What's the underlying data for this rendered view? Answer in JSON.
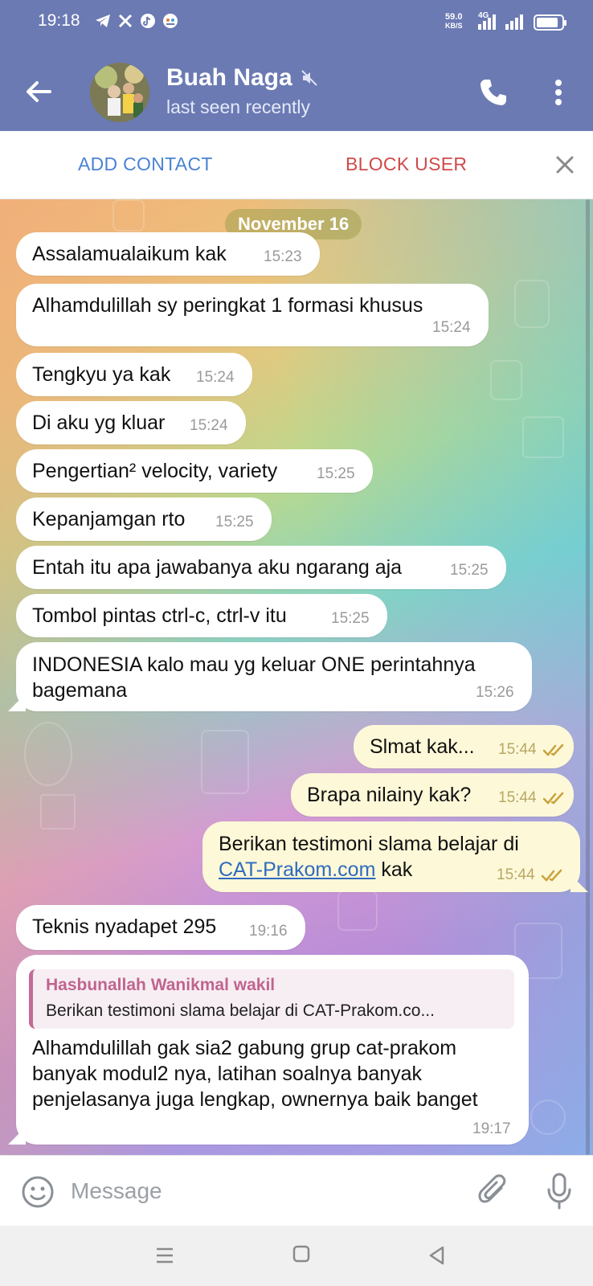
{
  "status_bar": {
    "time": "19:18",
    "net_speed_value": "59.0",
    "net_speed_unit": "KB/S",
    "network_type": "4G",
    "battery_level": 0.85,
    "notification_icons": [
      "telegram-icon",
      "x-icon",
      "tiktok-icon",
      "chat-app-icon"
    ]
  },
  "header": {
    "name": "Buah Naga",
    "status": "last seen recently",
    "muted": true
  },
  "action_bar": {
    "add_contact": "ADD CONTACT",
    "block_user": "BLOCK USER"
  },
  "chat": {
    "date": "November 16",
    "messages": [
      {
        "dir": "in",
        "text": "Assalamualaikum kak",
        "time": "15:23"
      },
      {
        "dir": "in",
        "text": "Alhamdulillah sy peringkat 1 formasi khusus",
        "time": "15:24"
      },
      {
        "dir": "in",
        "text": "Tengkyu ya kak",
        "time": "15:24"
      },
      {
        "dir": "in",
        "text": "Di aku yg kluar",
        "time": "15:24"
      },
      {
        "dir": "in",
        "text": "Pengertian² velocity, variety",
        "time": "15:25"
      },
      {
        "dir": "in",
        "text": "Kepanjamgan rto",
        "time": "15:25"
      },
      {
        "dir": "in",
        "text": "Entah itu apa jawabanya aku ngarang aja",
        "time": "15:25"
      },
      {
        "dir": "in",
        "text": "Tombol pintas ctrl-c, ctrl-v itu",
        "time": "15:25"
      },
      {
        "dir": "in",
        "text": "INDONESIA kalo mau yg keluar ONE perintahnya bagemana",
        "time": "15:26"
      },
      {
        "dir": "out",
        "text": "Slmat kak...",
        "time": "15:44",
        "read": true
      },
      {
        "dir": "out",
        "text": "Brapa nilainy kak?",
        "time": "15:44",
        "read": true
      },
      {
        "dir": "out",
        "text_before": "Berikan testimoni slama belajar di",
        "link": "CAT-Prakom.com",
        "text_after": "kak",
        "time": "15:44",
        "read": true
      },
      {
        "dir": "in",
        "text": "Teknis nyadapet 295",
        "time": "19:16"
      },
      {
        "dir": "in",
        "reply_name": "Hasbunallah Wanikmal wakil",
        "reply_text": "Berikan testimoni slama belajar di CAT-Prakom.co...",
        "text": "Alhamdulillah gak sia2 gabung grup cat-prakom banyak modul2 nya, latihan soalnya banyak penjelasanya juga lengkap, ownernya baik banget",
        "time": "19:17"
      }
    ]
  },
  "input": {
    "placeholder": "Message",
    "value": ""
  },
  "colors": {
    "header_bg": "#6b7ab3",
    "add_contact": "#4a83d4",
    "block_user": "#d04a4a",
    "incoming_bubble": "#ffffff",
    "outgoing_bubble": "#fdf8d8",
    "reply_accent": "#c46a96"
  }
}
